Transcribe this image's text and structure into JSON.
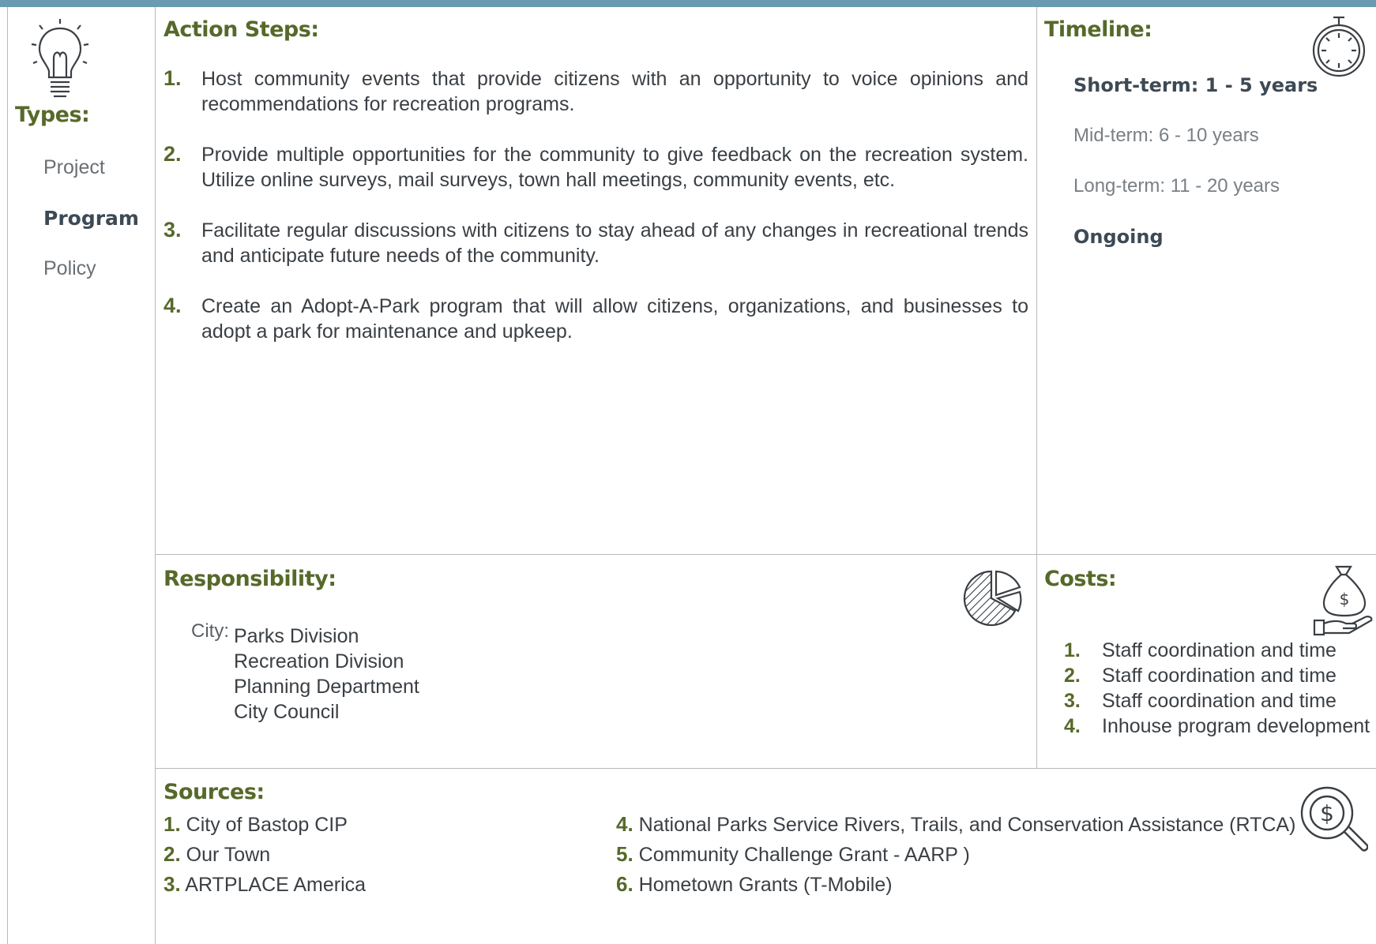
{
  "types": {
    "heading": "Types:",
    "items": [
      "Project",
      "Program",
      "Policy"
    ]
  },
  "action_steps": {
    "heading": "Action Steps:",
    "items": [
      {
        "num": "1.",
        "text": "Host community events that provide citizens with an opportunity to voice opinions and recommendations for recreation programs."
      },
      {
        "num": "2.",
        "text": "Provide multiple opportunities for the community to give feedback on the recreation system. Utilize online surveys, mail surveys, town hall meetings, community events, etc."
      },
      {
        "num": "3.",
        "text": "Facilitate regular discussions with citizens to stay ahead of any changes in recreational trends and anticipate future needs of the community."
      },
      {
        "num": "4.",
        "text": "Create an Adopt-A-Park program that will allow citizens, organizations, and businesses to adopt a park for maintenance and upkeep."
      }
    ]
  },
  "timeline": {
    "heading": "Timeline:",
    "short": "Short-term:  1 - 5 years",
    "mid": "Mid-term:  6 - 10 years",
    "long": "Long-term:  11 - 20 years",
    "ongoing": "Ongoing"
  },
  "responsibility": {
    "heading": "Responsibility:",
    "label": "City:",
    "items": [
      "Parks Division",
      "Recreation Division",
      "Planning Department",
      "City Council"
    ]
  },
  "costs": {
    "heading": "Costs:",
    "items": [
      {
        "num": "1.",
        "text": "Staff coordination and time"
      },
      {
        "num": "2.",
        "text": "Staff coordination and time"
      },
      {
        "num": "3.",
        "text": "Staff coordination and time"
      },
      {
        "num": "4.",
        "text": "Inhouse program development"
      }
    ]
  },
  "sources": {
    "heading": "Sources:",
    "items": [
      {
        "num": "1.",
        "text": "City of Bastop CIP"
      },
      {
        "num": "2.",
        "text": "Our Town"
      },
      {
        "num": "3.",
        "text": "ARTPLACE America"
      },
      {
        "num": "4.",
        "text": "National Parks Service Rivers, Trails, and Conservation Assistance (RTCA)"
      },
      {
        "num": "5.",
        "text": "Community Challenge Grant - AARP )"
      },
      {
        "num": "6.",
        "text": "Hometown Grants (T-Mobile)"
      }
    ]
  },
  "icons": [
    "lightbulb-icon",
    "stopwatch-icon",
    "pie-chart-icon",
    "money-bag-hand-icon",
    "dollar-search-icon"
  ],
  "colors": {
    "accent_green": "#56692a",
    "top_bar": "#6a9bb1",
    "dark_text": "#3d4a55"
  }
}
